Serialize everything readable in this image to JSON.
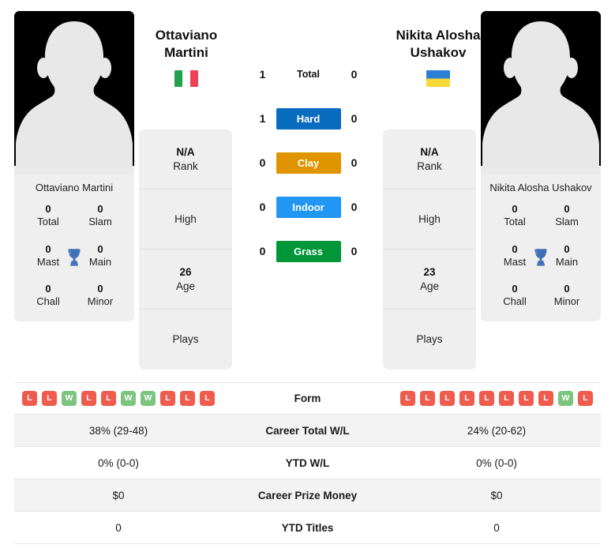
{
  "players": {
    "left": {
      "name": "Ottaviano Martini",
      "name_line1": "Ottaviano",
      "name_line2": "Martini",
      "flag": "italy-flag",
      "rank_value": "N/A",
      "rank_label": "Rank",
      "high_label": "High",
      "age_value": "26",
      "age_label": "Age",
      "plays_label": "Plays",
      "titles": [
        {
          "num": "0",
          "label": "Total"
        },
        {
          "num": "0",
          "label": "Slam"
        },
        {
          "num": "0",
          "label": "Mast"
        },
        {
          "num": "0",
          "label": "Main"
        },
        {
          "num": "0",
          "label": "Chall"
        },
        {
          "num": "0",
          "label": "Minor"
        }
      ],
      "form": [
        "L",
        "L",
        "W",
        "L",
        "L",
        "W",
        "W",
        "L",
        "L",
        "L"
      ],
      "career_total_wl": "38% (29-48)",
      "ytd_wl": "0% (0-0)",
      "career_prize_money": "$0",
      "ytd_titles": "0"
    },
    "right": {
      "name": "Nikita Alosha Ushakov",
      "name_line1": "Nikita Alosha",
      "name_line2": "Ushakov",
      "flag": "ukraine-flag",
      "rank_value": "N/A",
      "rank_label": "Rank",
      "high_label": "High",
      "age_value": "23",
      "age_label": "Age",
      "plays_label": "Plays",
      "titles": [
        {
          "num": "0",
          "label": "Total"
        },
        {
          "num": "0",
          "label": "Slam"
        },
        {
          "num": "0",
          "label": "Mast"
        },
        {
          "num": "0",
          "label": "Main"
        },
        {
          "num": "0",
          "label": "Chall"
        },
        {
          "num": "0",
          "label": "Minor"
        }
      ],
      "form": [
        "L",
        "L",
        "L",
        "L",
        "L",
        "L",
        "L",
        "L",
        "W",
        "L"
      ],
      "career_total_wl": "24% (20-62)",
      "ytd_wl": "0% (0-0)",
      "career_prize_money": "$0",
      "ytd_titles": "0"
    }
  },
  "h2h": [
    {
      "label": "Total",
      "left": "1",
      "right": "0",
      "color": "none",
      "text": "#111111"
    },
    {
      "label": "Hard",
      "left": "1",
      "right": "0",
      "color": "#0a6cbe",
      "text": "#ffffff"
    },
    {
      "label": "Clay",
      "left": "0",
      "right": "0",
      "color": "#e09400",
      "text": "#ffffff"
    },
    {
      "label": "Indoor",
      "left": "0",
      "right": "0",
      "color": "#2196f3",
      "text": "#ffffff"
    },
    {
      "label": "Grass",
      "left": "0",
      "right": "0",
      "color": "#009639",
      "text": "#ffffff"
    }
  ],
  "table": {
    "rows": [
      {
        "label": "Form",
        "kind": "form"
      },
      {
        "label": "Career Total W/L",
        "kind": "text",
        "left": "38% (29-48)",
        "right": "24% (20-62)"
      },
      {
        "label": "YTD W/L",
        "kind": "text",
        "left": "0% (0-0)",
        "right": "0% (0-0)"
      },
      {
        "label": "Career Prize Money",
        "kind": "text",
        "left": "$0",
        "right": "$0"
      },
      {
        "label": "YTD Titles",
        "kind": "text",
        "left": "0",
        "right": "0"
      }
    ]
  },
  "colors": {
    "win_badge": "#ef5b4c",
    "loss_badge": "#ef5b4c",
    "win_green": "#7cc47f",
    "trophy": "#3f6fb5",
    "card_bg": "#efefef",
    "row_shade": "#f3f3f3"
  }
}
